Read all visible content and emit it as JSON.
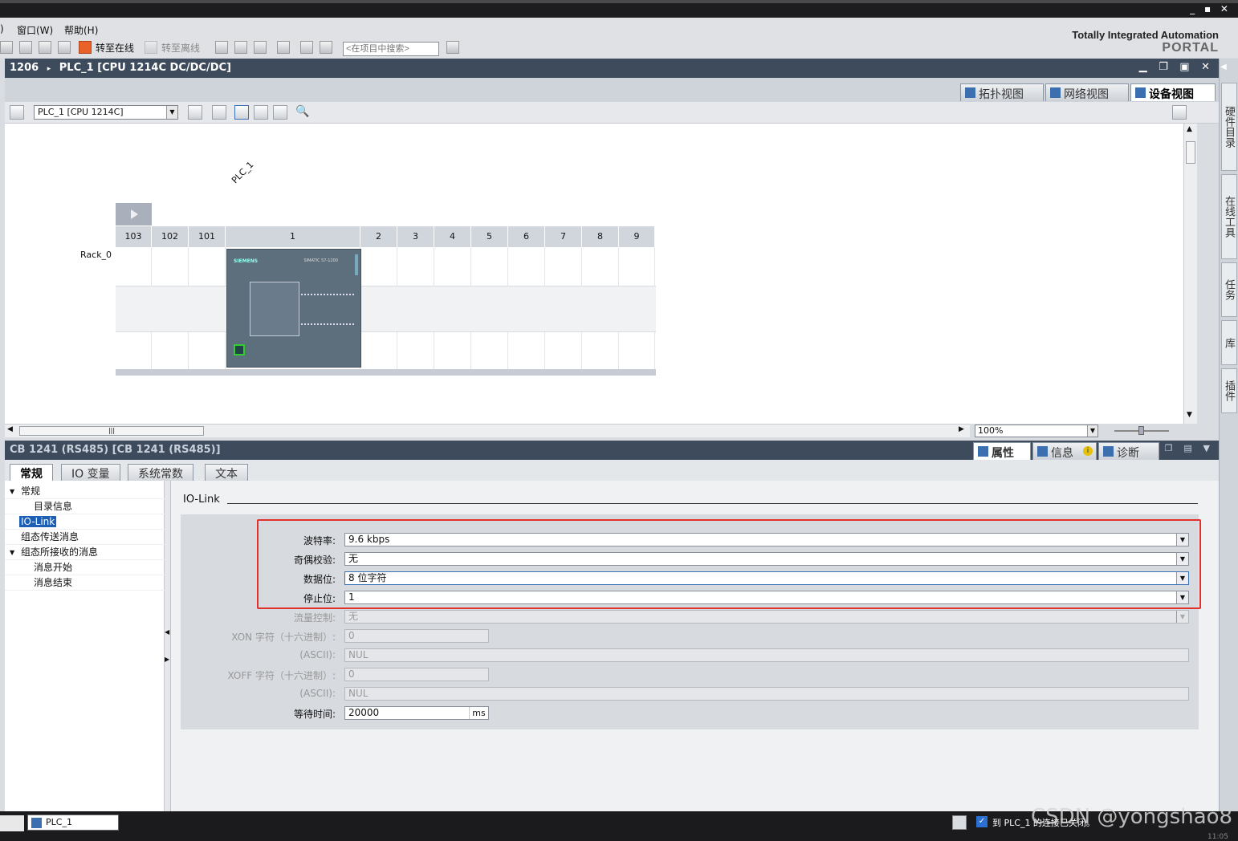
{
  "menu": {
    "items": [
      ")",
      "窗口(W)",
      "帮助(H)"
    ]
  },
  "toolbar": {
    "go_online": "转至在线",
    "go_offline": "转至离线",
    "search_placeholder": "<在项目中搜索>"
  },
  "brand": {
    "line1": "Totally Integrated Automation",
    "line2": "PORTAL"
  },
  "editor": {
    "breadcrumb_root": "1206",
    "breadcrumb_sep": "▸",
    "breadcrumb_item": "PLC_1 [CPU 1214C DC/DC/DC]",
    "view_tabs": [
      "拓扑视图",
      "网络视图",
      "设备视图"
    ],
    "device_select": "PLC_1 [CPU 1214C]",
    "zoom": "100%"
  },
  "rack": {
    "plc_label": "PLC_1",
    "rack_label": "Rack_0",
    "slots": [
      "103",
      "102",
      "101",
      "1",
      "2",
      "3",
      "4",
      "5",
      "6",
      "7",
      "8",
      "9"
    ],
    "cpu_brand": "SIEMENS",
    "cpu_model": "SIMATIC S7-1200"
  },
  "right_dock": {
    "tabs": [
      "硬件目录",
      "在线工具",
      "任务",
      "库",
      "插件"
    ]
  },
  "inspector": {
    "title": "CB 1241 (RS485) [CB 1241 (RS485)]",
    "tabs": [
      "属性",
      "信息",
      "诊断"
    ],
    "subtabs": [
      "常规",
      "IO 变量",
      "系统常数",
      "文本"
    ],
    "tree": [
      "常规",
      "目录信息",
      "IO-Link",
      "组态传送消息",
      "组态所接收的消息",
      "消息开始",
      "消息结束"
    ],
    "section_title": "IO-Link",
    "fields": {
      "baud_label": "波特率:",
      "baud_value": "9.6 kbps",
      "parity_label": "奇偶校验:",
      "parity_value": "无",
      "databits_label": "数据位:",
      "databits_value": "8 位字符",
      "stopbits_label": "停止位:",
      "stopbits_value": "1",
      "flow_label": "流量控制:",
      "flow_value": "无",
      "xon_label": "XON 字符（十六进制）:",
      "xon_value": "0",
      "xon_ascii_label": "(ASCII):",
      "xon_ascii_value": "NUL",
      "xoff_label": "XOFF 字符（十六进制）:",
      "xoff_value": "0",
      "xoff_ascii_label": "(ASCII):",
      "xoff_ascii_value": "NUL",
      "wait_label": "等待时间:",
      "wait_value": "20000",
      "wait_unit": "ms"
    }
  },
  "statusbar": {
    "task_plc": "PLC_1",
    "message": "到 PLC_1 的连接已关闭。",
    "watermark": "CSDN @yongshao8",
    "clock": "11:05"
  },
  "colors": {
    "highlight": "#e0312a",
    "header": "#3d4b5c",
    "selection": "#1c5fb5"
  }
}
